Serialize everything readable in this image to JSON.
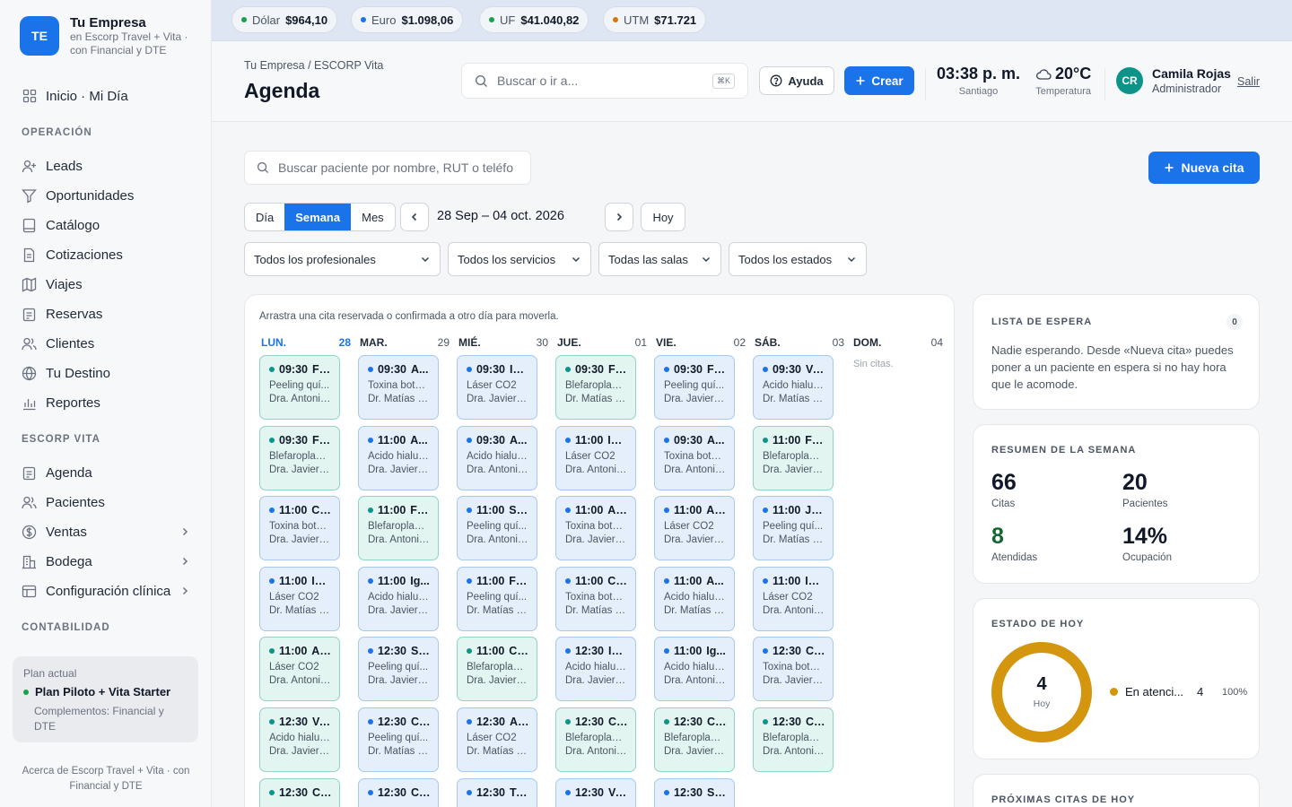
{
  "brand": {
    "initials": "TE",
    "name": "Tu Empresa",
    "sub": "en Escorp Travel + Vita · con Financial y DTE"
  },
  "sidebar": {
    "home": "Inicio · Mi Día",
    "sections": {
      "operacion": "OPERACIÓN",
      "escorp": "ESCORP VITA",
      "contabilidad": "CONTABILIDAD"
    },
    "operacion": [
      "Leads",
      "Oportunidades",
      "Catálogo",
      "Cotizaciones",
      "Viajes",
      "Reservas",
      "Clientes",
      "Tu Destino",
      "Reportes"
    ],
    "escorp": [
      "Agenda",
      "Pacientes",
      "Ventas",
      "Bodega",
      "Configuración clínica"
    ],
    "plan": {
      "label": "Plan actual",
      "name": "Plan Piloto + Vita Starter",
      "sub": "Complementos: Financial y DTE"
    },
    "about": "Acerca de Escorp Travel + Vita · con Financial y DTE"
  },
  "rates": [
    {
      "label": "Dólar",
      "value": "$964,10",
      "color": "#16a34a"
    },
    {
      "label": "Euro",
      "value": "$1.098,06",
      "color": "#1a73e8"
    },
    {
      "label": "UF",
      "value": "$41.040,82",
      "color": "#16a34a"
    },
    {
      "label": "UTM",
      "value": "$71.721",
      "color": "#d97706"
    }
  ],
  "header": {
    "breadcrumb": "Tu Empresa / ESCORP Vita",
    "title": "Agenda",
    "search_placeholder": "Buscar o ir a...",
    "search_kbd": "⌘K",
    "help": "Ayuda",
    "create": "Crear",
    "time": "03:38 p. m.",
    "city": "Santiago",
    "temp": "20°C",
    "temp_label": "Temperatura",
    "user_initials": "CR",
    "user_name": "Camila Rojas",
    "user_role": "Administrador",
    "logout": "Salir"
  },
  "toolbar": {
    "patient_search": "Buscar paciente por nombre, RUT o teléfo",
    "new_appt": "Nueva cita",
    "views": [
      "Día",
      "Semana",
      "Mes"
    ],
    "active_view": "Semana",
    "range": "28 Sep – 04 oct. 2026",
    "today": "Hoy",
    "filters": [
      "Todos los profesionales",
      "Todos los servicios",
      "Todas las salas",
      "Todos los estados"
    ]
  },
  "calendar": {
    "hint": "Arrastra una cita reservada o confirmada a otro día para moverla.",
    "days": [
      {
        "name": "LUN.",
        "num": "28"
      },
      {
        "name": "MAR.",
        "num": "29"
      },
      {
        "name": "MIÉ.",
        "num": "30"
      },
      {
        "name": "JUE.",
        "num": "01"
      },
      {
        "name": "VIE.",
        "num": "02"
      },
      {
        "name": "SÁB.",
        "num": "03"
      },
      {
        "name": "DOM.",
        "num": "04"
      }
    ],
    "empty": "Sin citas.",
    "columns": [
      [
        {
          "time": "09:30",
          "name": "Fl...",
          "service": "Peeling quí...",
          "doctor": "Dra. Antonia ...",
          "status": "green"
        },
        {
          "time": "09:30",
          "name": "Fe...",
          "service": "Blefaroplastia",
          "doctor": "Dra. Javiera ...",
          "status": "green"
        },
        {
          "time": "11:00",
          "name": "Ca...",
          "service": "Toxina botul...",
          "doctor": "Dra. Javiera ...",
          "status": "blue"
        },
        {
          "time": "11:00",
          "name": "Isi...",
          "service": "Láser CO2",
          "doctor": "Dr. Matías C...",
          "status": "blue"
        },
        {
          "time": "11:00",
          "name": "An...",
          "service": "Láser CO2",
          "doctor": "Dra. Antonia ...",
          "status": "green"
        },
        {
          "time": "12:30",
          "name": "Va...",
          "service": "Ácido hialur...",
          "doctor": "Dra. Javiera ...",
          "status": "green"
        },
        {
          "time": "12:30",
          "name": "Co...",
          "service": "",
          "doctor": "",
          "status": "green"
        }
      ],
      [
        {
          "time": "09:30",
          "name": "A...",
          "service": "Toxina botul...",
          "doctor": "Dr. Matías C...",
          "status": "blue"
        },
        {
          "time": "11:00",
          "name": "A...",
          "service": "Ácido hialur...",
          "doctor": "Dra. Javiera ...",
          "status": "blue"
        },
        {
          "time": "11:00",
          "name": "Fe...",
          "service": "Blefaroplastia",
          "doctor": "Dra. Antonia ...",
          "status": "green"
        },
        {
          "time": "11:00",
          "name": "Ig...",
          "service": "Ácido hialur...",
          "doctor": "Dra. Javiera ...",
          "status": "blue"
        },
        {
          "time": "12:30",
          "name": "So...",
          "service": "Peeling quí...",
          "doctor": "Dra. Javiera ...",
          "status": "blue"
        },
        {
          "time": "12:30",
          "name": "Co...",
          "service": "Peeling quí...",
          "doctor": "Dr. Matías C...",
          "status": "blue"
        },
        {
          "time": "12:30",
          "name": "Ca...",
          "service": "",
          "doctor": "",
          "status": "blue"
        }
      ],
      [
        {
          "time": "09:30",
          "name": "Isi...",
          "service": "Láser CO2",
          "doctor": "Dra. Javiera ...",
          "status": "blue"
        },
        {
          "time": "09:30",
          "name": "A...",
          "service": "Ácido hialur...",
          "doctor": "Dra. Antonia ...",
          "status": "blue"
        },
        {
          "time": "11:00",
          "name": "So...",
          "service": "Peeling quí...",
          "doctor": "Dra. Antonia ...",
          "status": "blue"
        },
        {
          "time": "11:00",
          "name": "Flo...",
          "service": "Peeling quí...",
          "doctor": "Dr. Matías C...",
          "status": "blue"
        },
        {
          "time": "11:00",
          "name": "Co...",
          "service": "Blefaroplastia",
          "doctor": "Dra. Javiera ...",
          "status": "green"
        },
        {
          "time": "12:30",
          "name": "An...",
          "service": "Láser CO2",
          "doctor": "Dr. Matías C...",
          "status": "blue"
        },
        {
          "time": "12:30",
          "name": "Tri...",
          "service": "",
          "doctor": "",
          "status": "blue"
        }
      ],
      [
        {
          "time": "09:30",
          "name": "Fe...",
          "service": "Blefaroplastia",
          "doctor": "Dr. Matías C...",
          "status": "green"
        },
        {
          "time": "11:00",
          "name": "Isi...",
          "service": "Láser CO2",
          "doctor": "Dra. Antonia ...",
          "status": "blue"
        },
        {
          "time": "11:00",
          "name": "Ag...",
          "service": "Toxina botul...",
          "doctor": "Dra. Javiera ...",
          "status": "blue"
        },
        {
          "time": "11:00",
          "name": "Ca...",
          "service": "Toxina botul...",
          "doctor": "Dr. Matías C...",
          "status": "blue"
        },
        {
          "time": "12:30",
          "name": "Ig...",
          "service": "Ácido hialur...",
          "doctor": "Dra. Javiera ...",
          "status": "blue"
        },
        {
          "time": "12:30",
          "name": "Co...",
          "service": "Blefaroplastia",
          "doctor": "Dra. Antonia ...",
          "status": "green"
        },
        {
          "time": "12:30",
          "name": "Va...",
          "service": "",
          "doctor": "",
          "status": "blue"
        }
      ],
      [
        {
          "time": "09:30",
          "name": "Fl...",
          "service": "Peeling quí...",
          "doctor": "Dra. Javiera ...",
          "status": "blue"
        },
        {
          "time": "09:30",
          "name": "A...",
          "service": "Toxina botul...",
          "doctor": "Dra. Antonia ...",
          "status": "blue"
        },
        {
          "time": "11:00",
          "name": "An...",
          "service": "Láser CO2",
          "doctor": "Dra. Javiera ...",
          "status": "blue"
        },
        {
          "time": "11:00",
          "name": "A...",
          "service": "Ácido hialur...",
          "doctor": "Dr. Matías C...",
          "status": "blue"
        },
        {
          "time": "11:00",
          "name": "Ig...",
          "service": "Ácido hialur...",
          "doctor": "Dra. Antonia ...",
          "status": "blue"
        },
        {
          "time": "12:30",
          "name": "Ca...",
          "service": "Blefaroplastia",
          "doctor": "Dra. Javiera ...",
          "status": "green"
        },
        {
          "time": "12:30",
          "name": "So...",
          "service": "",
          "doctor": "",
          "status": "blue"
        }
      ],
      [
        {
          "time": "09:30",
          "name": "Va...",
          "service": "Ácido hialur...",
          "doctor": "Dr. Matías C...",
          "status": "blue"
        },
        {
          "time": "11:00",
          "name": "Fe...",
          "service": "Blefaroplastia",
          "doctor": "Dra. Javiera ...",
          "status": "green"
        },
        {
          "time": "11:00",
          "name": "Jo...",
          "service": "Peeling quí...",
          "doctor": "Dr. Matías C...",
          "status": "blue"
        },
        {
          "time": "11:00",
          "name": "Isi...",
          "service": "Láser CO2",
          "doctor": "Dra. Antonia ...",
          "status": "blue"
        },
        {
          "time": "12:30",
          "name": "Ca...",
          "service": "Toxina botul...",
          "doctor": "Dra. Javiera ...",
          "status": "blue"
        },
        {
          "time": "12:30",
          "name": "Co...",
          "service": "Blefaroplastia",
          "doctor": "Dra. Antonia ...",
          "status": "green"
        }
      ]
    ]
  },
  "waitlist": {
    "title": "LISTA DE ESPERA",
    "count": "0",
    "text": "Nadie esperando. Desde «Nueva cita» puedes poner a un paciente en espera si no hay hora que le acomode."
  },
  "summary": {
    "title": "RESUMEN DE LA SEMANA",
    "citas": {
      "value": "66",
      "label": "Citas"
    },
    "pacientes": {
      "value": "20",
      "label": "Pacientes"
    },
    "atendidas": {
      "value": "8",
      "label": "Atendidas"
    },
    "ocupacion": {
      "value": "14%",
      "label": "Ocupación"
    }
  },
  "today_status": {
    "title": "ESTADO DE HOY",
    "total": "4",
    "total_label": "Hoy",
    "legend_label": "En atenci...",
    "legend_count": "4",
    "legend_pct": "100%",
    "ring_fraction": 1.0,
    "ring_color": "#d4960f"
  },
  "upcoming": {
    "title": "PRÓXIMAS CITAS DE HOY"
  },
  "colors": {
    "accent": "#1a73e8",
    "status_blue": "#1a73e8",
    "status_green": "#0d9488"
  }
}
